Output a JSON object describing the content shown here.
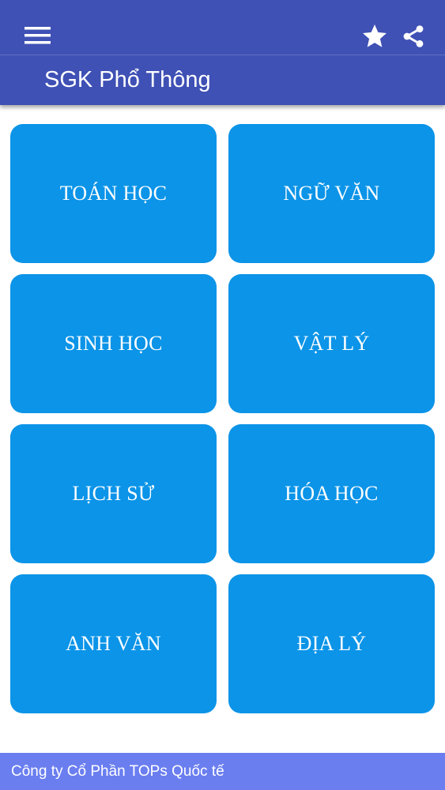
{
  "app_bar": {
    "title": "SGK Phổ Thông",
    "background_color": "#3f51b5",
    "icons": {
      "menu": "menu-icon",
      "favorite": "star-icon",
      "share": "share-icon"
    }
  },
  "subjects": [
    {
      "label": "TOÁN HỌC"
    },
    {
      "label": "NGỮ VĂN"
    },
    {
      "label": "SINH HỌC"
    },
    {
      "label": "VẬT LÝ"
    },
    {
      "label": "LỊCH SỬ"
    },
    {
      "label": "HÓA HỌC"
    },
    {
      "label": "ANH VĂN"
    },
    {
      "label": "ĐỊA LÝ"
    }
  ],
  "tile_color": "#0b94e8",
  "footer": {
    "text": "Công ty Cổ Phần TOPs Quốc tế",
    "background_color": "#6a7ef0"
  }
}
